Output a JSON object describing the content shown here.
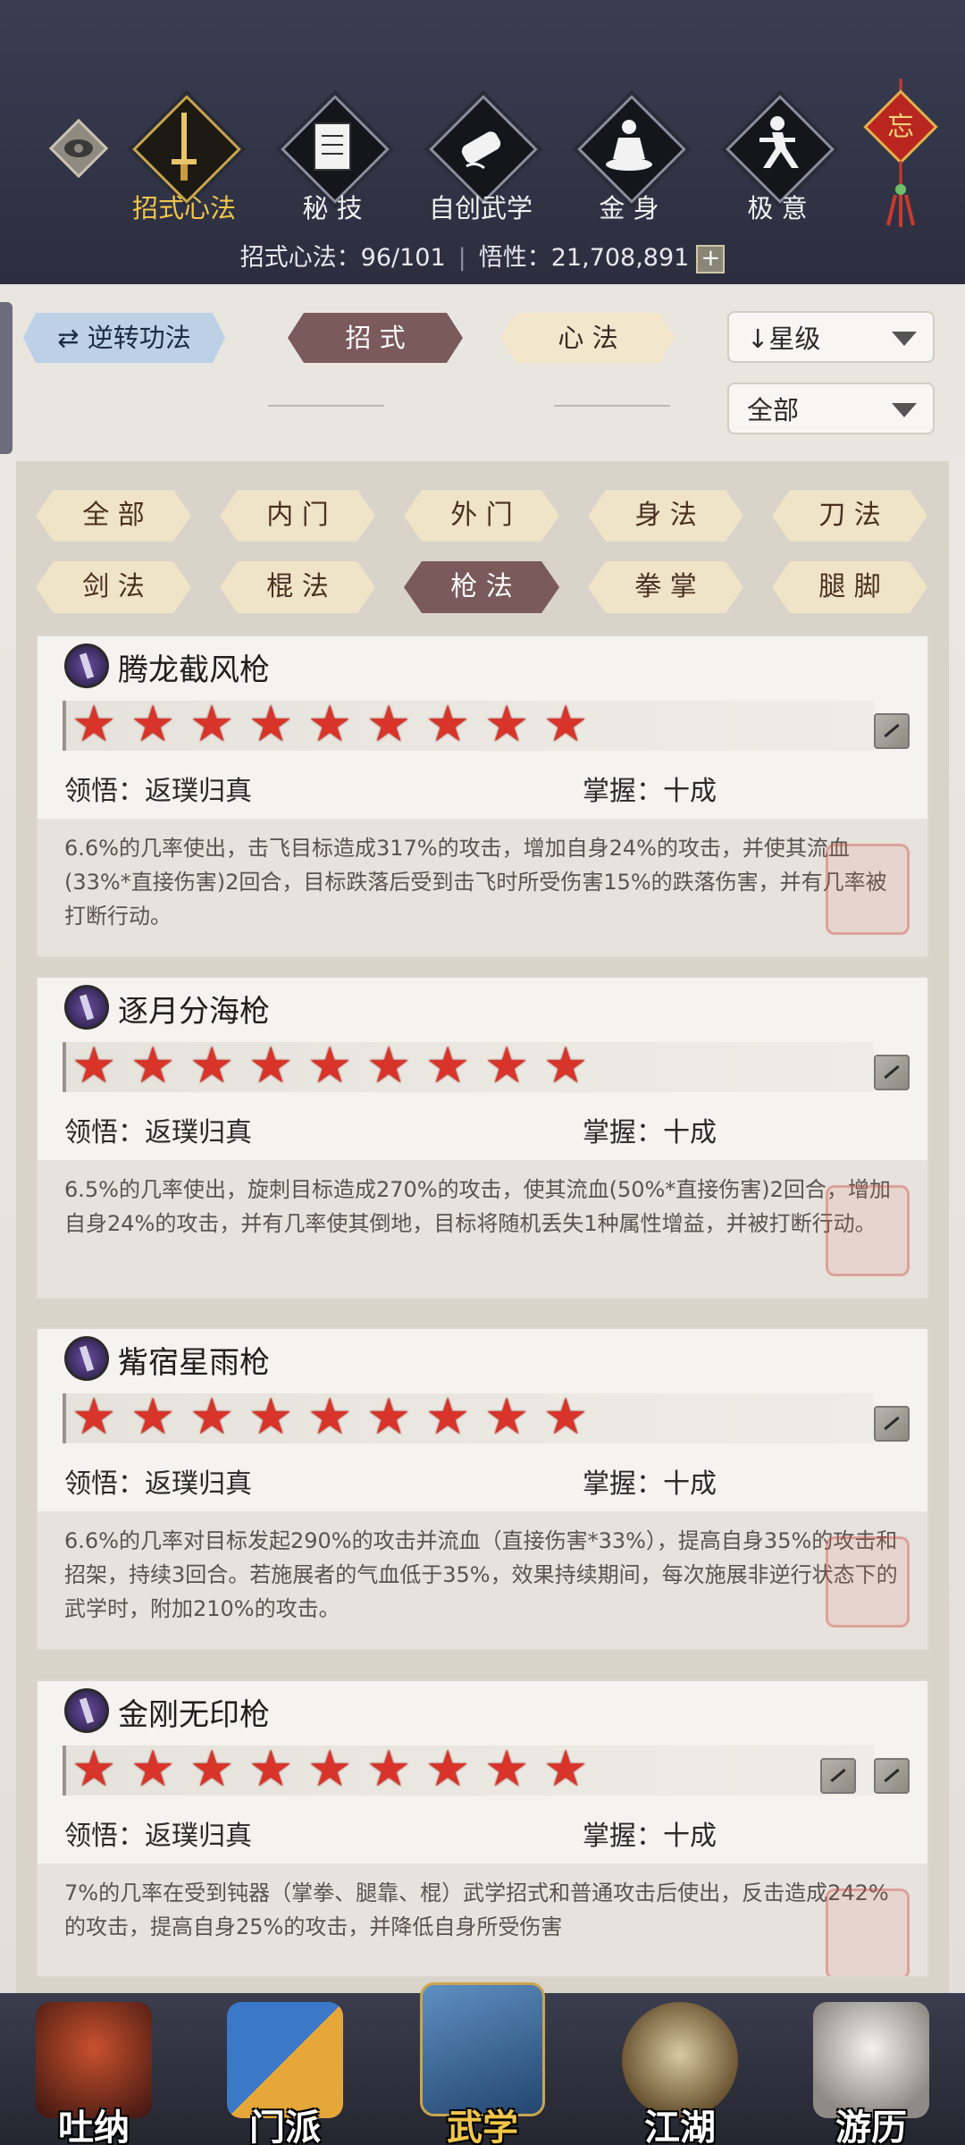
{
  "top_tabs": [
    {
      "label": "招式心法",
      "icon": "sword-icon",
      "active": true
    },
    {
      "label": "秘 技",
      "icon": "book-icon",
      "active": false
    },
    {
      "label": "自创武学",
      "icon": "scroll-icon",
      "active": false
    },
    {
      "label": "金 身",
      "icon": "meditation-icon",
      "active": false
    },
    {
      "label": "极 意",
      "icon": "martial-stance-icon",
      "active": false
    }
  ],
  "knot_char": "忘",
  "stats": {
    "skills": "招式心法：96/101",
    "insight": "悟性：21,708,891",
    "plus": "+"
  },
  "controls": {
    "reverse_label": "逆转功法",
    "tab_zhaoshi": "招 式",
    "tab_xinfa": "心 法",
    "sort_label": "星级",
    "sort_arrow": "↓",
    "filter_all": "全部"
  },
  "filters": [
    "全 部",
    "内 门",
    "外 门",
    "身 法",
    "刀 法",
    "剑 法",
    "棍 法",
    "枪 法",
    "拳 掌",
    "腿 脚"
  ],
  "selected_filter": "枪 法",
  "cards": [
    {
      "name": "腾龙截风枪",
      "stars": 9,
      "lingwu": "领悟：返璞归真",
      "zhangwo": "掌握：十成",
      "desc": "6.6%的几率使出，击飞目标造成317%的攻击，增加自身24%的攻击，并使其流血(33%*直接伤害)2回合，目标跌落后受到击飞时所受伤害15%的跌落伤害，并有几率被打断行动。"
    },
    {
      "name": "逐月分海枪",
      "stars": 9,
      "lingwu": "领悟：返璞归真",
      "zhangwo": "掌握：十成",
      "desc": "6.5%的几率使出，旋刺目标造成270%的攻击，使其流血(50%*直接伤害)2回合，增加自身24%的攻击，并有几率使其倒地，目标将随机丢失1种属性增益，并被打断行动。"
    },
    {
      "name": "觜宿星雨枪",
      "stars": 9,
      "lingwu": "领悟：返璞归真",
      "zhangwo": "掌握：十成",
      "desc": "6.6%的几率对目标发起290%的攻击并流血（直接伤害*33%），提高自身35%的攻击和招架，持续3回合。若施展者的气血低于35%，效果持续期间，每次施展非逆行状态下的武学时，附加210%的攻击。"
    },
    {
      "name": "金刚无印枪",
      "stars": 9,
      "lingwu": "领悟：返璞归真",
      "zhangwo": "掌握：十成",
      "desc": "7%的几率在受到钝器（掌拳、腿靠、棍）武学招式和普通攻击后使出，反击造成242%的攻击，提高自身25%的攻击，并降低自身所受伤害"
    }
  ],
  "bottom_nav": [
    {
      "label": "吐纳",
      "icon": "monk-meditating-icon",
      "active": false
    },
    {
      "label": "门派",
      "icon": "sect-flags-icon",
      "active": false
    },
    {
      "label": "武学",
      "icon": "martial-books-icon",
      "active": true
    },
    {
      "label": "江湖",
      "icon": "straw-hat-icon",
      "active": false
    },
    {
      "label": "游历",
      "icon": "white-horse-icon",
      "active": false
    }
  ]
}
